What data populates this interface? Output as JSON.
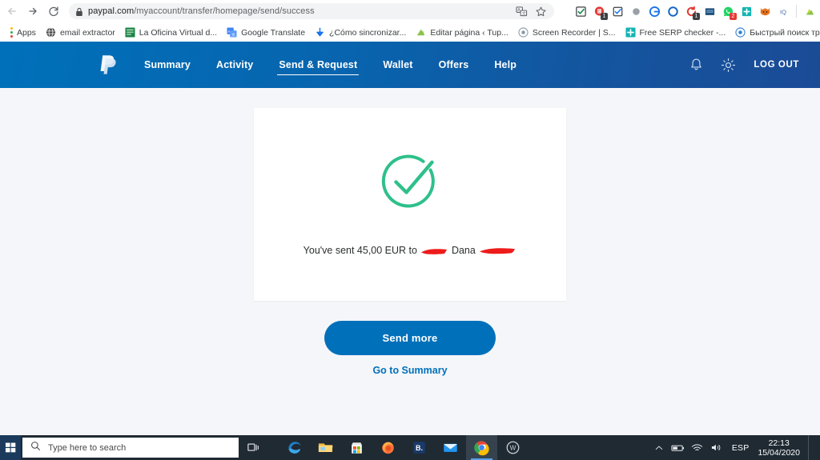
{
  "browser": {
    "nav": {
      "back_icon": "arrow-left-icon",
      "forward_icon": "arrow-right-icon",
      "reload_icon": "reload-icon"
    },
    "omnibox": {
      "lock_icon": "lock-icon",
      "url_domain": "paypal.com",
      "url_path": "/myaccount/transfer/homepage/send/success",
      "translate_icon": "translate-icon",
      "bookmark_icon": "star-icon"
    },
    "extensions": [
      {
        "name": "checkbox-green-extension-icon",
        "badge": ""
      },
      {
        "name": "stop-record-extension-icon",
        "badge": "1"
      },
      {
        "name": "checkbox-blue-extension-icon",
        "badge": ""
      },
      {
        "name": "gray-circle-extension-icon",
        "badge": ""
      },
      {
        "name": "power-blue-extension-icon",
        "badge": ""
      },
      {
        "name": "circle-outline-extension-icon",
        "badge": ""
      },
      {
        "name": "red-refresh-extension-icon",
        "badge": "1"
      },
      {
        "name": "blue-square-extension-icon",
        "badge": ""
      },
      {
        "name": "whatsapp-green-extension-icon",
        "badge": "2"
      },
      {
        "name": "teal-plus-extension-icon",
        "badge": ""
      },
      {
        "name": "fox-extension-icon",
        "badge": ""
      },
      {
        "name": "iq-extension-icon",
        "badge": ""
      },
      {
        "name": "profile-avatar-icon",
        "badge": ""
      }
    ],
    "bookmarks": [
      {
        "label": "Apps",
        "icon": "apps-grid-icon"
      },
      {
        "label": "email extractor",
        "icon": "globe-icon"
      },
      {
        "label": "La Oficina Virtual d...",
        "icon": "green-doc-icon"
      },
      {
        "label": "Google Translate",
        "icon": "translate-icon"
      },
      {
        "label": "¿Cómo sincronizar...",
        "icon": "blue-arrow-down-icon"
      },
      {
        "label": "Editar página ‹ Tup...",
        "icon": "green-leaf-icon"
      },
      {
        "label": "Screen Recorder | S...",
        "icon": "record-circle-icon"
      },
      {
        "label": "Free SERP checker -...",
        "icon": "teal-plus-icon"
      },
      {
        "label": "Быстрый поиск тр...",
        "icon": "blue-record-icon"
      }
    ]
  },
  "paypal": {
    "logo_icon": "paypal-logo-icon",
    "nav": [
      {
        "label": "Summary",
        "active": false
      },
      {
        "label": "Activity",
        "active": false
      },
      {
        "label": "Send & Request",
        "active": true
      },
      {
        "label": "Wallet",
        "active": false
      },
      {
        "label": "Offers",
        "active": false
      },
      {
        "label": "Help",
        "active": false
      }
    ],
    "notifications_icon": "bell-icon",
    "settings_icon": "gear-icon",
    "logout_label": "LOG OUT",
    "success": {
      "check_icon": "success-check-circle-icon",
      "message_prefix": "You've sent 45,00 EUR to",
      "message_name": "Dana",
      "amount": "45,00",
      "currency": "EUR",
      "redaction_color": "#ee1b1b"
    },
    "send_more_label": "Send more",
    "go_to_summary_label": "Go to Summary",
    "colors": {
      "header_blue": "#0070ba",
      "button_blue": "#0070ba",
      "success_green": "#2ec08b",
      "page_bg": "#f5f6f9"
    }
  },
  "taskbar": {
    "start_icon": "windows-start-icon",
    "search_icon": "search-icon",
    "search_placeholder": "Type here to search",
    "taskview_icon": "task-view-icon",
    "apps": [
      {
        "name": "edge-icon",
        "active": false
      },
      {
        "name": "file-explorer-icon",
        "active": false
      },
      {
        "name": "microsoft-store-icon",
        "active": false
      },
      {
        "name": "firefox-icon",
        "active": false
      },
      {
        "name": "booking-icon",
        "active": false
      },
      {
        "name": "mail-icon",
        "active": false
      },
      {
        "name": "chrome-icon",
        "active": true
      },
      {
        "name": "wps-writer-icon",
        "active": false
      }
    ],
    "tray": {
      "chevron_icon": "chevron-up-icon",
      "battery_icon": "battery-icon",
      "wifi_icon": "wifi-icon",
      "volume_icon": "volume-icon",
      "language": "ESP",
      "time": "22:13",
      "date": "15/04/2020"
    }
  }
}
